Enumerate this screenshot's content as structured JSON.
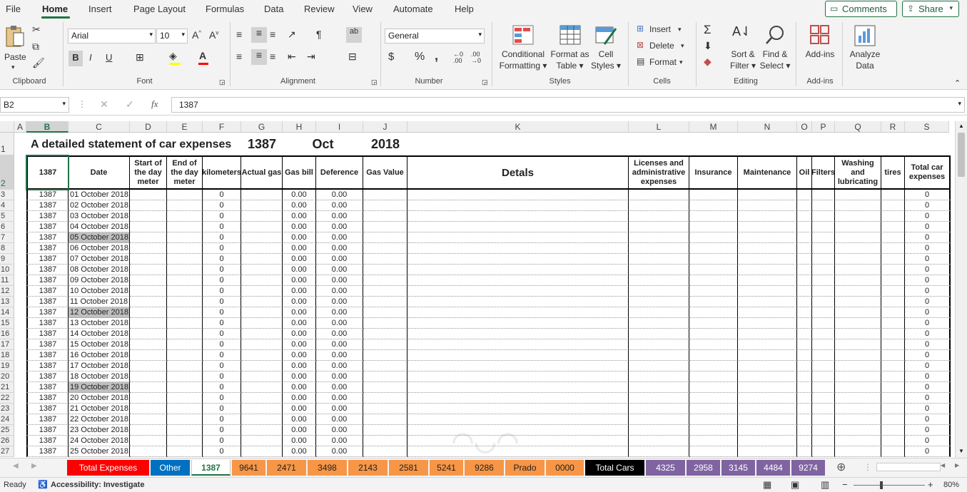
{
  "menu": {
    "items": [
      "File",
      "Home",
      "Insert",
      "Page Layout",
      "Formulas",
      "Data",
      "Review",
      "View",
      "Automate",
      "Help"
    ],
    "active": "Home",
    "comments_label": "Comments",
    "share_label": "Share"
  },
  "ribbon": {
    "clipboard": {
      "paste": "Paste",
      "group": "Clipboard"
    },
    "font": {
      "family": "Arial",
      "size": "10",
      "group": "Font",
      "bold": "B",
      "italic": "I",
      "underline": "U"
    },
    "alignment": {
      "group": "Alignment"
    },
    "number": {
      "format": "General",
      "group": "Number",
      "currency": "$",
      "percent": "%",
      "comma": ","
    },
    "styles": {
      "conditional": "Conditional",
      "conditional2": "Formatting",
      "format_table": "Format as",
      "format_table2": "Table",
      "cell_styles": "Cell",
      "cell_styles2": "Styles",
      "group": "Styles"
    },
    "cells": {
      "insert": "Insert",
      "delete": "Delete",
      "format": "Format",
      "group": "Cells"
    },
    "editing": {
      "sort": "Sort &",
      "sort2": "Filter",
      "find": "Find &",
      "find2": "Select",
      "group": "Editing"
    },
    "addins": {
      "label": "Add-ins",
      "group": "Add-ins"
    },
    "analyze": {
      "label": "Analyze",
      "label2": "Data"
    }
  },
  "formula_bar": {
    "name_box": "B2",
    "formula": "1387",
    "fx": "fx"
  },
  "columns": [
    "A",
    "B",
    "C",
    "D",
    "E",
    "F",
    "G",
    "H",
    "I",
    "J",
    "K",
    "L",
    "M",
    "N",
    "O",
    "P",
    "Q",
    "R",
    "S"
  ],
  "title": {
    "text": "A detailed statement of car expenses",
    "car": "1387",
    "month": "Oct",
    "year": "2018"
  },
  "headers": {
    "B": "1387",
    "C": "Date",
    "D": "Start of the day meter",
    "E": "End of the day meter",
    "F": "kilometers",
    "G": "Actual gas",
    "H": "Gas bill",
    "I": "Deference",
    "J": "Gas Value",
    "K": "Detals",
    "L": "Licenses and administrative expenses",
    "M": "Insurance",
    "N": "Maintenance",
    "O": "Oil",
    "P": "Filters",
    "Q": "Washing and lubricating",
    "R": "tires",
    "S": "Total car expenses"
  },
  "rows": [
    {
      "n": "3",
      "date": "01 October 2018"
    },
    {
      "n": "4",
      "date": "02 October 2018"
    },
    {
      "n": "5",
      "date": "03 October 2018"
    },
    {
      "n": "6",
      "date": "04 October 2018"
    },
    {
      "n": "7",
      "date": "05 October 2018",
      "hl": true
    },
    {
      "n": "8",
      "date": "06 October 2018"
    },
    {
      "n": "9",
      "date": "07 October 2018"
    },
    {
      "n": "10",
      "date": "08 October 2018"
    },
    {
      "n": "11",
      "date": "09 October 2018"
    },
    {
      "n": "12",
      "date": "10 October 2018"
    },
    {
      "n": "13",
      "date": "11 October 2018"
    },
    {
      "n": "14",
      "date": "12 October 2018",
      "hl": true
    },
    {
      "n": "15",
      "date": "13 October 2018"
    },
    {
      "n": "16",
      "date": "14 October 2018"
    },
    {
      "n": "17",
      "date": "15 October 2018"
    },
    {
      "n": "18",
      "date": "16 October 2018"
    },
    {
      "n": "19",
      "date": "17 October 2018"
    },
    {
      "n": "20",
      "date": "18 October 2018"
    },
    {
      "n": "21",
      "date": "19 October 2018",
      "hl": true
    },
    {
      "n": "22",
      "date": "20 October 2018"
    },
    {
      "n": "23",
      "date": "21 October 2018"
    },
    {
      "n": "24",
      "date": "22 October 2018"
    },
    {
      "n": "25",
      "date": "23 October 2018"
    },
    {
      "n": "26",
      "date": "24 October 2018"
    },
    {
      "n": "27",
      "date": "25 October 2018"
    }
  ],
  "row_values": {
    "car": "1387",
    "km": "0",
    "gas_bill": "0.00",
    "deference": "0.00",
    "total": "0"
  },
  "sheet_tabs": [
    {
      "label": "Total Expenses",
      "color": "#ff0000",
      "fg": "#ffffff"
    },
    {
      "label": "Other",
      "color": "#0070c0",
      "fg": "#ffffff"
    },
    {
      "label": "1387",
      "color": "#ffffff",
      "fg": "#217346",
      "active": true
    },
    {
      "label": "9641",
      "color": "#f79646",
      "fg": "#222222"
    },
    {
      "label": "2471",
      "color": "#f79646",
      "fg": "#222222"
    },
    {
      "label": "3498",
      "color": "#f79646",
      "fg": "#222222"
    },
    {
      "label": "2143",
      "color": "#f79646",
      "fg": "#222222"
    },
    {
      "label": "2581",
      "color": "#f79646",
      "fg": "#222222"
    },
    {
      "label": "5241",
      "color": "#f79646",
      "fg": "#222222"
    },
    {
      "label": "9286",
      "color": "#f79646",
      "fg": "#222222"
    },
    {
      "label": "Prado",
      "color": "#f79646",
      "fg": "#222222"
    },
    {
      "label": "0000",
      "color": "#f79646",
      "fg": "#222222"
    },
    {
      "label": "Total Cars",
      "color": "#000000",
      "fg": "#ffffff"
    },
    {
      "label": "4325",
      "color": "#8064a2",
      "fg": "#ffffff"
    },
    {
      "label": "2958",
      "color": "#8064a2",
      "fg": "#ffffff"
    },
    {
      "label": "3145",
      "color": "#8064a2",
      "fg": "#ffffff"
    },
    {
      "label": "4484",
      "color": "#8064a2",
      "fg": "#ffffff"
    },
    {
      "label": "9274",
      "color": "#8064a2",
      "fg": "#ffffff"
    }
  ],
  "status": {
    "ready": "Ready",
    "accessibility": "Accessibility: Investigate",
    "zoom": "80%"
  }
}
